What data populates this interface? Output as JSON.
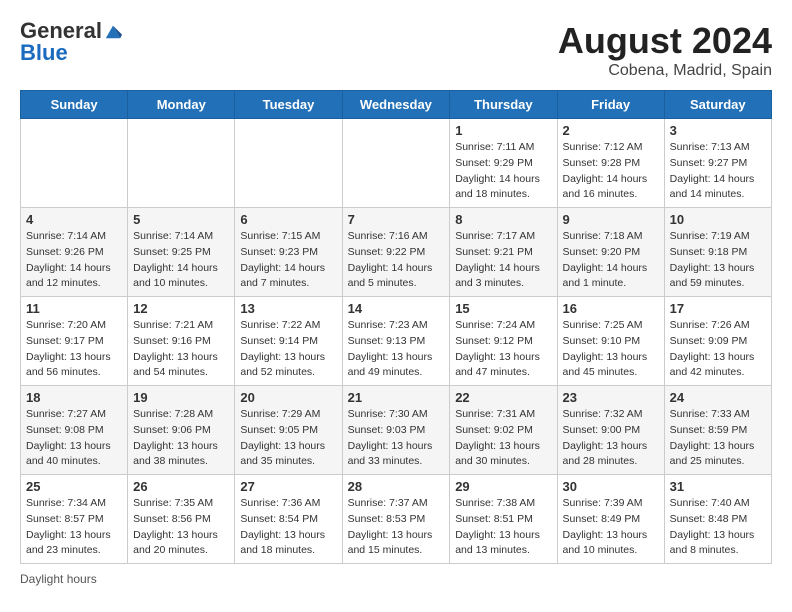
{
  "header": {
    "logo_general": "General",
    "logo_blue": "Blue",
    "month_year": "August 2024",
    "location": "Cobena, Madrid, Spain"
  },
  "weekdays": [
    "Sunday",
    "Monday",
    "Tuesday",
    "Wednesday",
    "Thursday",
    "Friday",
    "Saturday"
  ],
  "weeks": [
    [
      {
        "day": "",
        "info": ""
      },
      {
        "day": "",
        "info": ""
      },
      {
        "day": "",
        "info": ""
      },
      {
        "day": "",
        "info": ""
      },
      {
        "day": "1",
        "info": "Sunrise: 7:11 AM\nSunset: 9:29 PM\nDaylight: 14 hours and 18 minutes."
      },
      {
        "day": "2",
        "info": "Sunrise: 7:12 AM\nSunset: 9:28 PM\nDaylight: 14 hours and 16 minutes."
      },
      {
        "day": "3",
        "info": "Sunrise: 7:13 AM\nSunset: 9:27 PM\nDaylight: 14 hours and 14 minutes."
      }
    ],
    [
      {
        "day": "4",
        "info": "Sunrise: 7:14 AM\nSunset: 9:26 PM\nDaylight: 14 hours and 12 minutes."
      },
      {
        "day": "5",
        "info": "Sunrise: 7:14 AM\nSunset: 9:25 PM\nDaylight: 14 hours and 10 minutes."
      },
      {
        "day": "6",
        "info": "Sunrise: 7:15 AM\nSunset: 9:23 PM\nDaylight: 14 hours and 7 minutes."
      },
      {
        "day": "7",
        "info": "Sunrise: 7:16 AM\nSunset: 9:22 PM\nDaylight: 14 hours and 5 minutes."
      },
      {
        "day": "8",
        "info": "Sunrise: 7:17 AM\nSunset: 9:21 PM\nDaylight: 14 hours and 3 minutes."
      },
      {
        "day": "9",
        "info": "Sunrise: 7:18 AM\nSunset: 9:20 PM\nDaylight: 14 hours and 1 minute."
      },
      {
        "day": "10",
        "info": "Sunrise: 7:19 AM\nSunset: 9:18 PM\nDaylight: 13 hours and 59 minutes."
      }
    ],
    [
      {
        "day": "11",
        "info": "Sunrise: 7:20 AM\nSunset: 9:17 PM\nDaylight: 13 hours and 56 minutes."
      },
      {
        "day": "12",
        "info": "Sunrise: 7:21 AM\nSunset: 9:16 PM\nDaylight: 13 hours and 54 minutes."
      },
      {
        "day": "13",
        "info": "Sunrise: 7:22 AM\nSunset: 9:14 PM\nDaylight: 13 hours and 52 minutes."
      },
      {
        "day": "14",
        "info": "Sunrise: 7:23 AM\nSunset: 9:13 PM\nDaylight: 13 hours and 49 minutes."
      },
      {
        "day": "15",
        "info": "Sunrise: 7:24 AM\nSunset: 9:12 PM\nDaylight: 13 hours and 47 minutes."
      },
      {
        "day": "16",
        "info": "Sunrise: 7:25 AM\nSunset: 9:10 PM\nDaylight: 13 hours and 45 minutes."
      },
      {
        "day": "17",
        "info": "Sunrise: 7:26 AM\nSunset: 9:09 PM\nDaylight: 13 hours and 42 minutes."
      }
    ],
    [
      {
        "day": "18",
        "info": "Sunrise: 7:27 AM\nSunset: 9:08 PM\nDaylight: 13 hours and 40 minutes."
      },
      {
        "day": "19",
        "info": "Sunrise: 7:28 AM\nSunset: 9:06 PM\nDaylight: 13 hours and 38 minutes."
      },
      {
        "day": "20",
        "info": "Sunrise: 7:29 AM\nSunset: 9:05 PM\nDaylight: 13 hours and 35 minutes."
      },
      {
        "day": "21",
        "info": "Sunrise: 7:30 AM\nSunset: 9:03 PM\nDaylight: 13 hours and 33 minutes."
      },
      {
        "day": "22",
        "info": "Sunrise: 7:31 AM\nSunset: 9:02 PM\nDaylight: 13 hours and 30 minutes."
      },
      {
        "day": "23",
        "info": "Sunrise: 7:32 AM\nSunset: 9:00 PM\nDaylight: 13 hours and 28 minutes."
      },
      {
        "day": "24",
        "info": "Sunrise: 7:33 AM\nSunset: 8:59 PM\nDaylight: 13 hours and 25 minutes."
      }
    ],
    [
      {
        "day": "25",
        "info": "Sunrise: 7:34 AM\nSunset: 8:57 PM\nDaylight: 13 hours and 23 minutes."
      },
      {
        "day": "26",
        "info": "Sunrise: 7:35 AM\nSunset: 8:56 PM\nDaylight: 13 hours and 20 minutes."
      },
      {
        "day": "27",
        "info": "Sunrise: 7:36 AM\nSunset: 8:54 PM\nDaylight: 13 hours and 18 minutes."
      },
      {
        "day": "28",
        "info": "Sunrise: 7:37 AM\nSunset: 8:53 PM\nDaylight: 13 hours and 15 minutes."
      },
      {
        "day": "29",
        "info": "Sunrise: 7:38 AM\nSunset: 8:51 PM\nDaylight: 13 hours and 13 minutes."
      },
      {
        "day": "30",
        "info": "Sunrise: 7:39 AM\nSunset: 8:49 PM\nDaylight: 13 hours and 10 minutes."
      },
      {
        "day": "31",
        "info": "Sunrise: 7:40 AM\nSunset: 8:48 PM\nDaylight: 13 hours and 8 minutes."
      }
    ]
  ],
  "footer": {
    "daylight_label": "Daylight hours"
  }
}
